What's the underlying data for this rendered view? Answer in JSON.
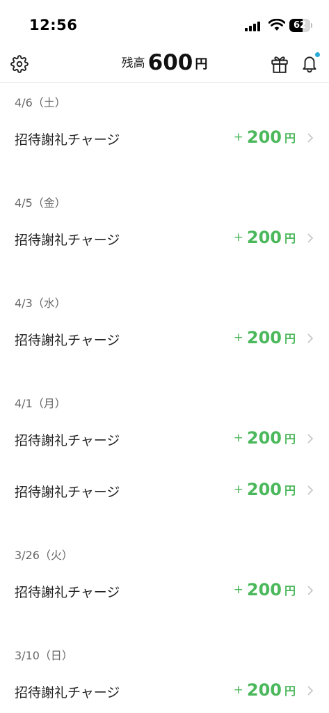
{
  "status": {
    "time": "12:56",
    "battery": "62",
    "battery_level": 0.62
  },
  "header": {
    "balance_label": "残高",
    "balance_amount": "600",
    "balance_unit": "円"
  },
  "colors": {
    "amount_green": "#4bb85c",
    "notification_dot": "#29a9d8"
  },
  "groups": [
    {
      "date": "4/6（土）",
      "items": [
        {
          "label": "招待謝礼チャージ",
          "sign": "+",
          "amount": "200",
          "unit": "円"
        }
      ]
    },
    {
      "date": "4/5（金）",
      "items": [
        {
          "label": "招待謝礼チャージ",
          "sign": "+",
          "amount": "200",
          "unit": "円"
        }
      ]
    },
    {
      "date": "4/3（水）",
      "items": [
        {
          "label": "招待謝礼チャージ",
          "sign": "+",
          "amount": "200",
          "unit": "円"
        }
      ]
    },
    {
      "date": "4/1（月）",
      "items": [
        {
          "label": "招待謝礼チャージ",
          "sign": "+",
          "amount": "200",
          "unit": "円"
        },
        {
          "label": "招待謝礼チャージ",
          "sign": "+",
          "amount": "200",
          "unit": "円"
        }
      ]
    },
    {
      "date": "3/26（火）",
      "items": [
        {
          "label": "招待謝礼チャージ",
          "sign": "+",
          "amount": "200",
          "unit": "円"
        }
      ]
    },
    {
      "date": "3/10（日）",
      "items": [
        {
          "label": "招待謝礼チャージ",
          "sign": "+",
          "amount": "200",
          "unit": "円"
        }
      ]
    }
  ]
}
